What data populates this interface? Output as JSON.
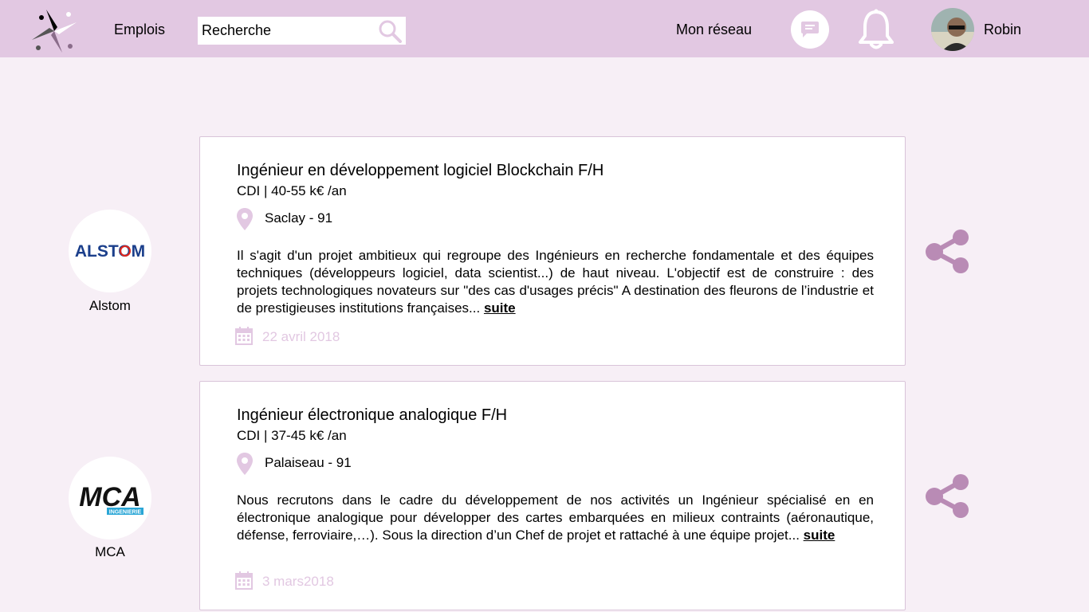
{
  "header": {
    "nav_jobs": "Emplois",
    "search_placeholder": "Recherche",
    "nav_network": "Mon réseau",
    "user_name": "Robin"
  },
  "colors": {
    "header_bg": "#e2c8e2",
    "page_bg": "#f7eff6",
    "accent": "#b98bb5",
    "date_text": "#e2c8e2"
  },
  "jobs": [
    {
      "title": "Ingénieur en développement logiciel Blockchain F/H",
      "meta": "CDI | 40-55 k€ /an",
      "location": "Saclay - 91",
      "description": "Il s'agit d'un projet ambitieux qui regroupe des Ingénieurs en recherche fondamentale et des équipes techniques (développeurs logiciel, data scientist...) de haut niveau. L'objectif est de construire : des projets technologiques novateurs sur \"des cas d'usages précis\" A destination des fleurons de l’industrie et de prestigieuses institutions françaises... ",
      "more": "suite ",
      "date": "22 avril 2018",
      "company": "Alstom",
      "company_logo_text": "ALSTOM"
    },
    {
      "title": "Ingénieur électronique analogique F/H",
      "meta": "CDI | 37-45 k€ /an",
      "location": "Palaiseau - 91",
      "description": "Nous recrutons dans le cadre du développement de nos activités un Ingénieur spécialisé en en électronique analogique pour développer des cartes embarquées en milieux contraints (aéronautique, défense, ferroviaire,…). Sous la direction d’un Chef de projet et rattaché à une équipe projet... ",
      "more": "suite ",
      "date": "3 mars2018",
      "company": "MCA",
      "company_logo_text": "MCA",
      "company_logo_subtext": "INGENIERIE"
    }
  ]
}
